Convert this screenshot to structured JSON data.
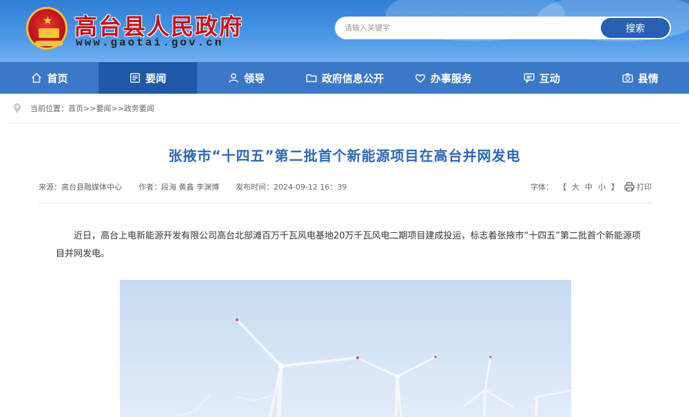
{
  "header": {
    "site_title": "高台县人民政府",
    "site_url": "www.gaotai.gov.cn",
    "search_placeholder": "请输入关键字",
    "search_button": "搜索"
  },
  "nav": {
    "items": [
      {
        "label": "首页",
        "icon": "home-icon"
      },
      {
        "label": "要闻",
        "icon": "news-icon"
      },
      {
        "label": "领导",
        "icon": "person-icon"
      },
      {
        "label": "政府信息公开",
        "icon": "folder-icon"
      },
      {
        "label": "办事服务",
        "icon": "heart-icon"
      },
      {
        "label": "互动",
        "icon": "chat-icon"
      },
      {
        "label": "县情",
        "icon": "camera-icon"
      }
    ],
    "active_index": 1
  },
  "breadcrumb": {
    "prefix": "当前位置：",
    "items": [
      "首页",
      "要闻",
      "政务要闻"
    ],
    "separator": ">>"
  },
  "article": {
    "title": "张掖市“十四五”第二批首个新能源项目在高台并网发电",
    "source_label": "来源：",
    "source": "高台县融媒体中心",
    "author_label": "作者：",
    "authors": "段海 黄鑫 李渊博",
    "time_label": "发布时间：",
    "time": "2024-09-12 16：39",
    "font_label": "字体：",
    "font_open": "【",
    "font_large": "大",
    "font_medium": "中",
    "font_small": "小",
    "font_close": "】",
    "print_label": "打印",
    "body": "近日，高台上电新能源开发有限公司高台北部滩百万千瓦风电基地20万千瓦风电二期项目建成投运，标志着张掖市“十四五”第二批首个新能源项目并网发电。"
  },
  "colors": {
    "header_blue": "#3a86dc",
    "nav_blue": "#3c78c8",
    "nav_active": "#1f5aa8",
    "title_red": "#c0141b",
    "article_title": "#2a68b6"
  }
}
